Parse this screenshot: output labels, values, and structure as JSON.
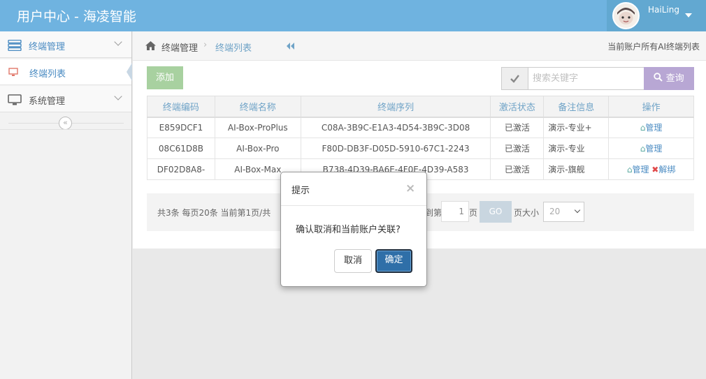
{
  "header": {
    "app_title": "用户中心 - 海凌智能",
    "user_name": "HaiLing"
  },
  "sidebar": {
    "items": [
      {
        "label": "终端管理",
        "icon": "server-icon",
        "expanded": true,
        "children": [
          {
            "label": "终端列表",
            "icon": "monitor-icon"
          }
        ]
      },
      {
        "label": "系统管理",
        "icon": "desktop-icon",
        "expanded": false
      }
    ]
  },
  "breadcrumb": {
    "level1": "终端管理",
    "level2": "终端列表",
    "right_text": "当前账户所有AI终端列表"
  },
  "toolbar": {
    "add_label": "添加",
    "search_placeholder": "搜索关键字",
    "search_label": "查询"
  },
  "table": {
    "headers": [
      "终端编码",
      "终端名称",
      "终端序列",
      "激活状态",
      "备注信息",
      "操作"
    ],
    "rows": [
      {
        "code": "E859DCF1",
        "name": "AI-Box-ProPlus",
        "serial": "C08A-3B9C-E1A3-4D54-3B9C-3D08",
        "status": "已激活",
        "note": "演示-专业+",
        "manage": "管理",
        "unbind": ""
      },
      {
        "code": "08C61D8B",
        "name": "AI-Box-Pro",
        "serial": "F80D-DB3F-D05D-5910-67C1-2243",
        "status": "已激活",
        "note": "演示-专业",
        "manage": "管理",
        "unbind": ""
      },
      {
        "code": "DF02D8A8-",
        "name": "AI-Box-Max",
        "serial": "B738-4D39-BA6E-4F0E-4D39-A583",
        "status": "已激活",
        "note": "演示-旗舰",
        "manage": "管理",
        "unbind": "解绑"
      }
    ]
  },
  "pager": {
    "summary": "共3条  每页20条  当前第1页/共",
    "di_label": "到第",
    "page_value": "1",
    "ye_label": "页",
    "go_label": "GO",
    "size_label": "页大小",
    "size_value": "20"
  },
  "modal": {
    "title": "提示",
    "close_glyph": "×",
    "message": "确认取消和当前账户关联?",
    "cancel_label": "取消",
    "ok_label": "确定"
  },
  "colors": {
    "header_bg": "#6fb3e0",
    "link": "#4a8bc2",
    "add_button": "#a8d1a0",
    "search_button": "#b8a7d4",
    "ok_button": "#2f6fa8"
  }
}
